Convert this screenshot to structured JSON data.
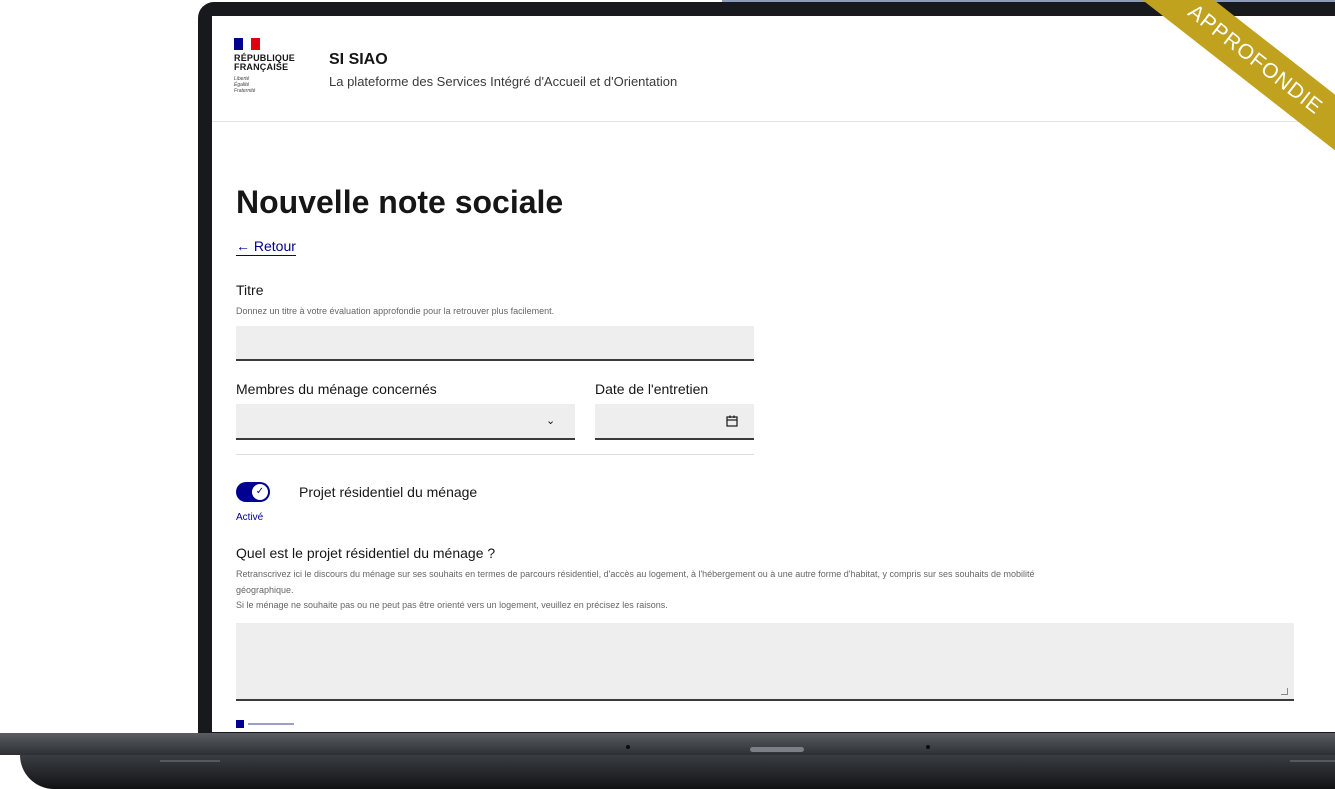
{
  "header": {
    "logo_line1": "RÉPUBLIQUE",
    "logo_line2": "FRANÇAISE",
    "logo_motto": [
      "Liberté",
      "Égalité",
      "Fraternité"
    ],
    "app_title": "SI SIAO",
    "app_subtitle": "La plateforme des Services Intégré d'Accueil et d'Orientation"
  },
  "ribbon": {
    "text": "APPROFONDIE"
  },
  "page": {
    "title": "Nouvelle note sociale",
    "back_link": "Retour"
  },
  "form": {
    "titre_label": "Titre",
    "titre_hint": "Donnez un titre à votre évaluation approfondie pour la retrouver plus facilement.",
    "titre_value": "",
    "membres_label": "Membres du ménage concernés",
    "membres_value": "",
    "date_label": "Date de l'entretien",
    "date_value": "",
    "toggle_label": "Projet résidentiel du ménage",
    "toggle_state": "Activé",
    "question_label": "Quel est le projet résidentiel du ménage ?",
    "question_hint_1": "Retranscrivez ici le discours du ménage sur ses souhaits en termes de parcours résidentiel, d'accès au logement, à l'hébergement ou à une autre forme d'habitat, y compris sur ses souhaits de mobilité",
    "question_hint_2": "géographique.",
    "question_hint_3": "Si le ménage ne souhaite pas ou ne peut pas être orienté vers un logement, veuillez en précisez les raisons.",
    "question_value": ""
  },
  "icons": {
    "back": "arrow-left-icon",
    "select": "chevron-down-icon",
    "date": "calendar-icon",
    "toggle": "check-icon"
  },
  "colors": {
    "primary": "#000091",
    "ribbon": "#c0a21e",
    "input_bg": "#eeeeee",
    "flag_blue": "#000091",
    "flag_red": "#e1000f"
  }
}
